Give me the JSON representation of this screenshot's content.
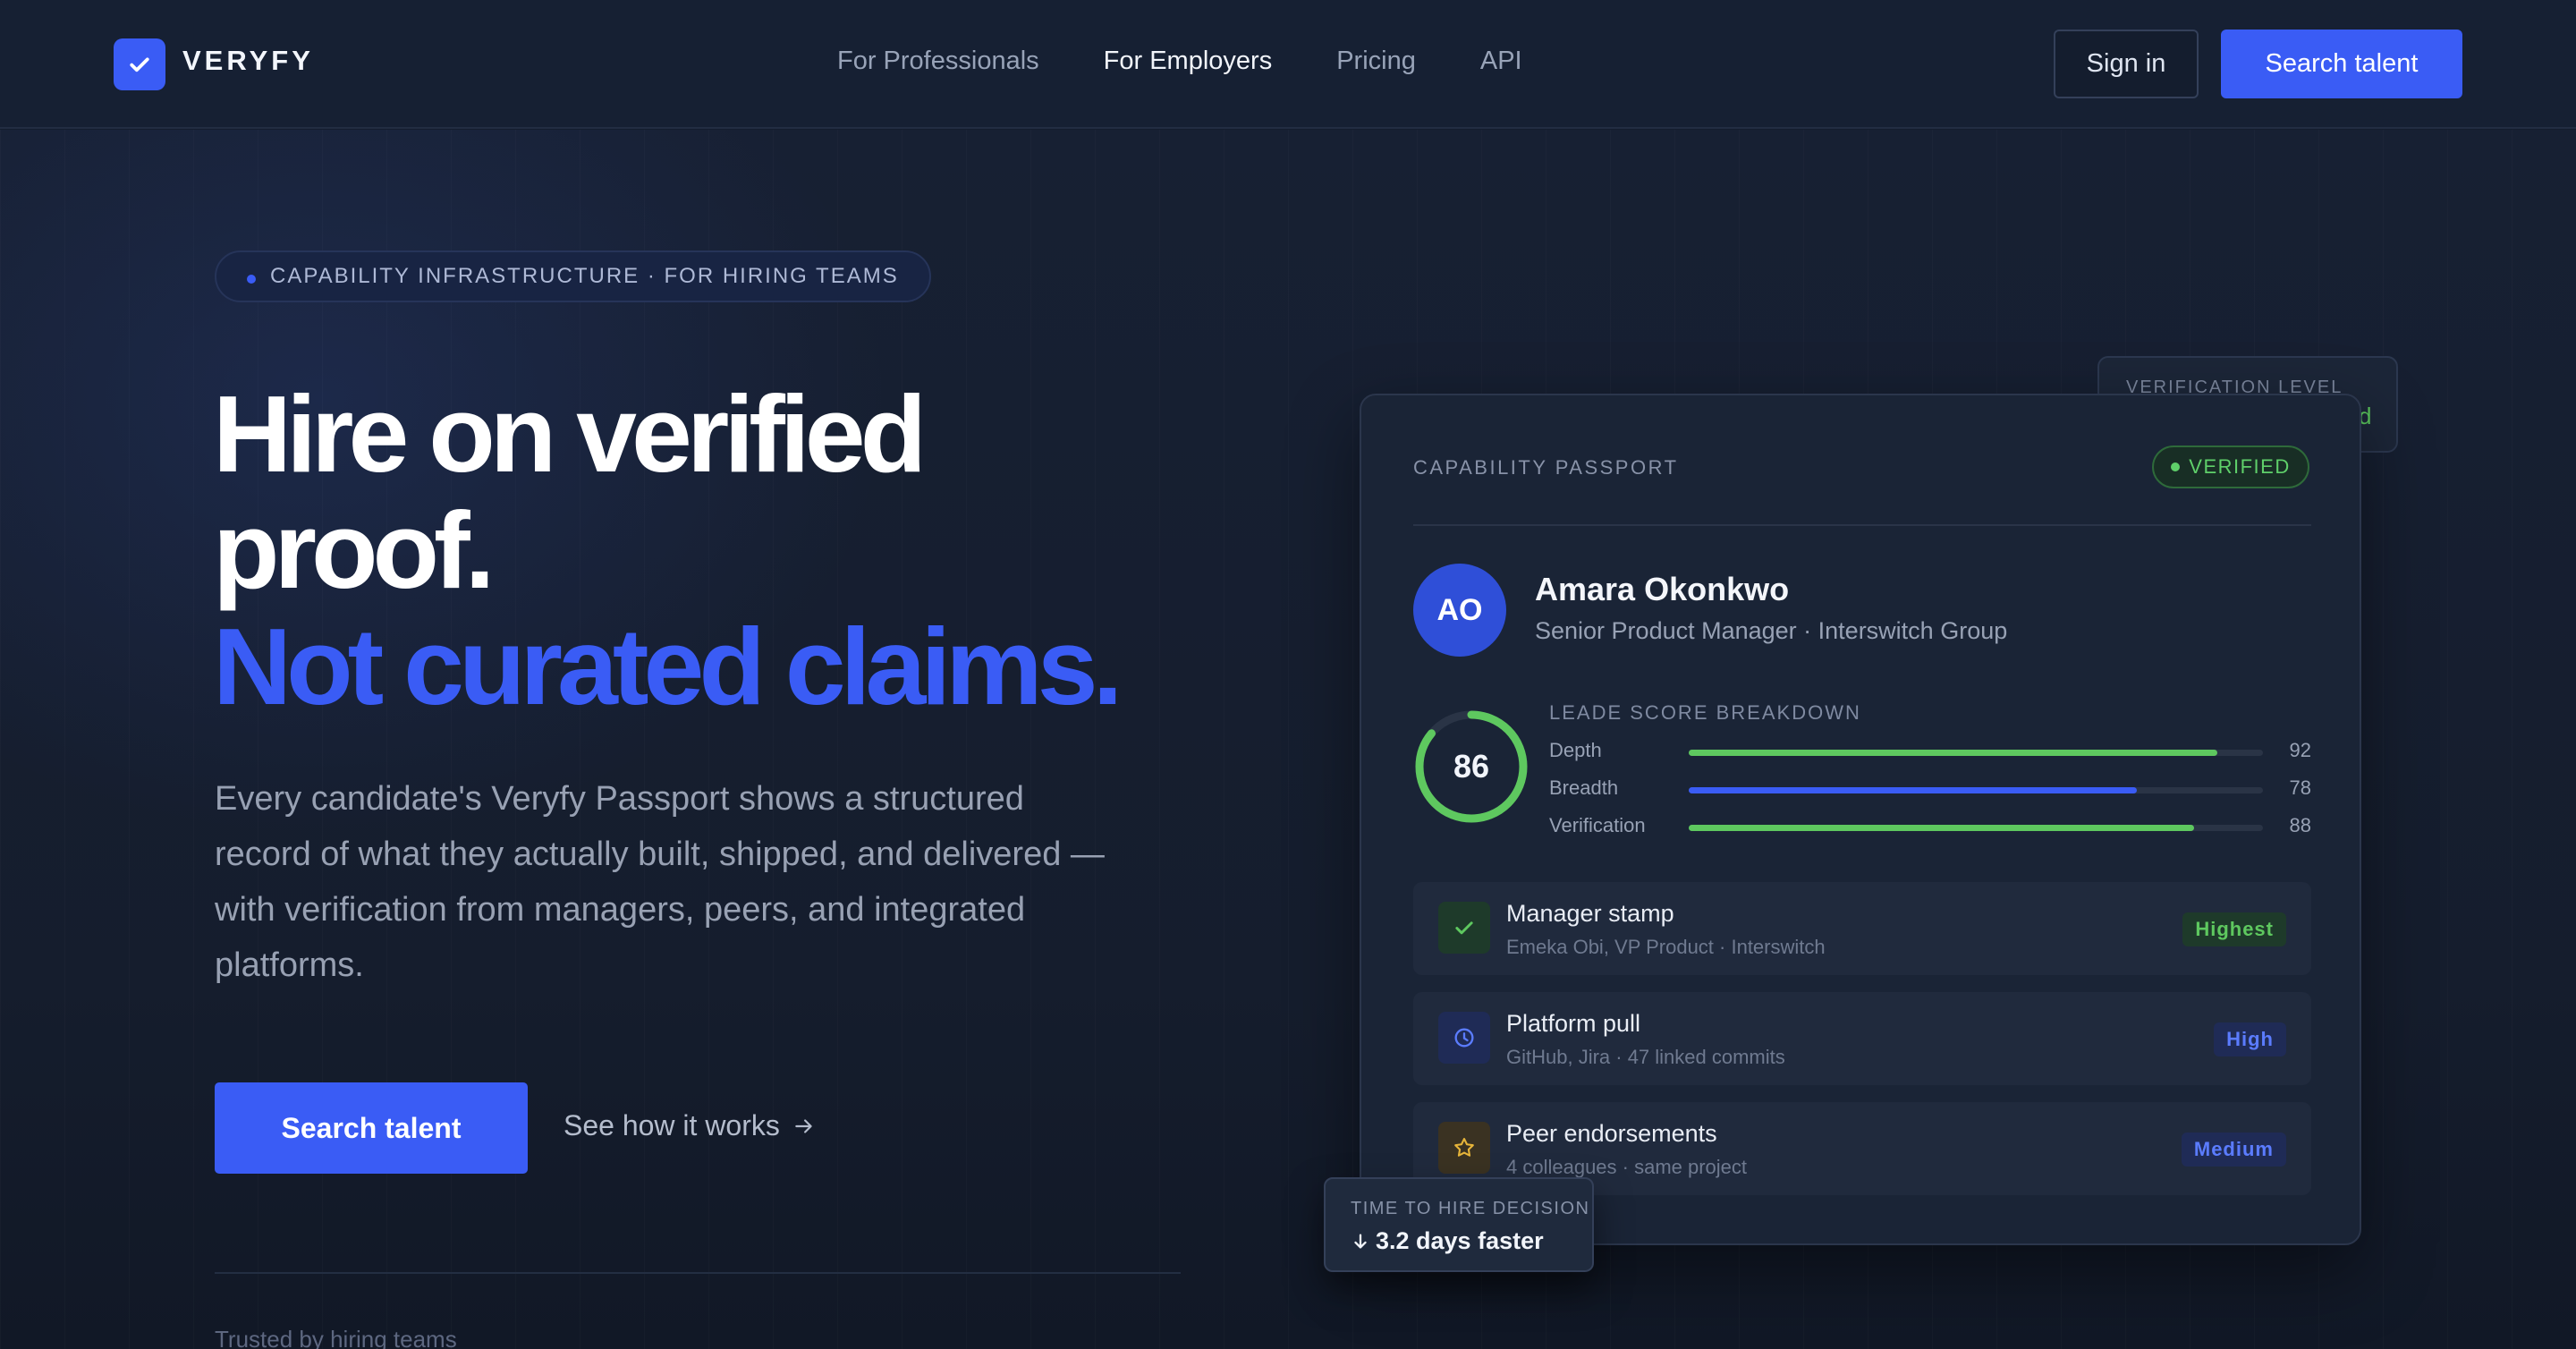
{
  "brand": {
    "name": "VERYFY"
  },
  "nav": {
    "links": [
      {
        "label": "For Professionals",
        "active": false
      },
      {
        "label": "For Employers",
        "active": true
      },
      {
        "label": "Pricing",
        "active": false
      },
      {
        "label": "API",
        "active": false
      }
    ],
    "sign_in": "Sign in",
    "cta": "Search talent"
  },
  "hero": {
    "eyebrow": "CAPABILITY INFRASTRUCTURE · FOR HIRING TEAMS",
    "headline_line1": "Hire on verified",
    "headline_line2": "proof.",
    "headline_accent": "Not curated claims.",
    "lead": "Every candidate's Veryfy Passport shows a structured record of what they actually built, shipped, and delivered — with verification from managers, peers, and integrated platforms.",
    "primary_cta": "Search talent",
    "secondary_cta": "See how it works",
    "trusted": "Trusted by hiring teams"
  },
  "verification_level": {
    "label": "VERIFICATION LEVEL",
    "value": "d"
  },
  "passport": {
    "label": "CAPABILITY PASSPORT",
    "status": "VERIFIED",
    "person": {
      "initials": "AO",
      "name": "Amara Okonkwo",
      "role": "Senior Product Manager · Interswitch Group"
    },
    "score": {
      "value": 86,
      "breakdown_label": "LEADE SCORE BREAKDOWN",
      "bars": [
        {
          "name": "Depth",
          "value": 92,
          "color": "#5ec85f"
        },
        {
          "name": "Breadth",
          "value": 78,
          "color": "#3a5cf5"
        },
        {
          "name": "Verification",
          "value": 88,
          "color": "#5ec85f"
        }
      ]
    },
    "evidence": [
      {
        "icon": "check-icon",
        "title": "Manager stamp",
        "sub": "Emeka Obi, VP Product · Interswitch",
        "tag": "Highest",
        "tag_color": "#5ec85f",
        "tag_bg": "#1e3a2a",
        "icon_bg": "#1e3a2a"
      },
      {
        "icon": "clock-icon",
        "title": "Platform pull",
        "sub": "GitHub, Jira · 47 linked commits",
        "tag": "High",
        "tag_color": "#5b7cff",
        "tag_bg": "#1f2b56",
        "icon_bg": "#1f2b56"
      },
      {
        "icon": "star-icon",
        "title": "Peer endorsements",
        "sub": "4 colleagues · same project",
        "tag": "Medium",
        "tag_color": "#5b7cff",
        "tag_bg": "#1f2b56",
        "icon_bg": "#3a3222"
      }
    ]
  },
  "time_to_hire": {
    "label": "TIME TO HIRE DECISION",
    "value": "3.2 days faster"
  },
  "colors": {
    "accent": "#3a5cf5",
    "success": "#5ec85f",
    "bg": "#141d2e"
  }
}
